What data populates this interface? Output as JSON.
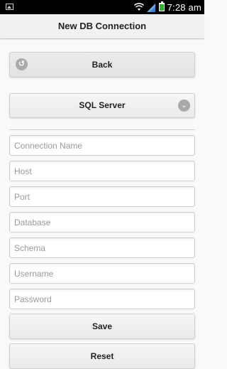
{
  "status_bar": {
    "time": "7:28 am",
    "icons": [
      "image-icon",
      "wifi-icon",
      "signal-icon",
      "battery-icon"
    ]
  },
  "header": {
    "title": "New DB Connection"
  },
  "back_button": {
    "label": "Back",
    "icon": "back-arrow-icon"
  },
  "db_type_select": {
    "selected": "SQL Server",
    "icon": "chevron-down-icon"
  },
  "fields": {
    "connection_name": {
      "placeholder": "Connection Name",
      "value": ""
    },
    "host": {
      "placeholder": "Host",
      "value": ""
    },
    "port": {
      "placeholder": "Port",
      "value": ""
    },
    "database": {
      "placeholder": "Database",
      "value": ""
    },
    "schema": {
      "placeholder": "Schema",
      "value": ""
    },
    "username": {
      "placeholder": "Username",
      "value": ""
    },
    "password": {
      "placeholder": "Password",
      "value": ""
    }
  },
  "actions": {
    "save_label": "Save",
    "reset_label": "Reset"
  },
  "colors": {
    "accent_battery": "#2fb32f",
    "icon_gray": "#a9a9a9",
    "background": "#f9f9f9"
  }
}
